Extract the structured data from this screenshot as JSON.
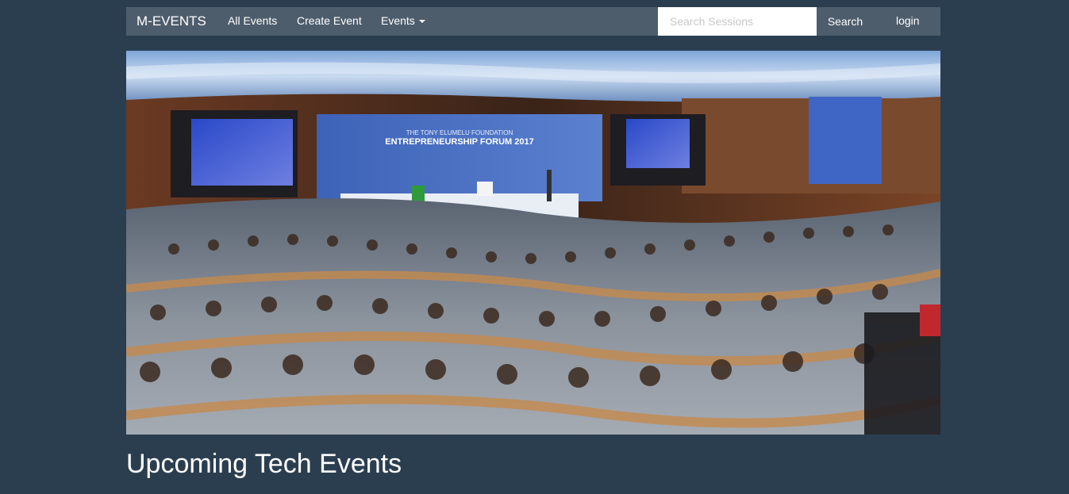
{
  "navbar": {
    "brand": "M-EVENTS",
    "links": [
      {
        "label": "All Events"
      },
      {
        "label": "Create Event"
      },
      {
        "label": "Events"
      }
    ],
    "search_placeholder": "Search Sessions",
    "search_value": "",
    "search_button": "Search",
    "login": "login"
  },
  "hero": {
    "banner_text": "THE TONY ELUMELU FOUNDATION",
    "banner_title": "ENTREPRENEURSHIP FORUM 2017"
  },
  "main": {
    "section_title": "Upcoming Tech Events"
  },
  "colors": {
    "page_bg": "#2b3e50",
    "navbar_bg": "#4e5d6c",
    "text": "#ffffff"
  }
}
